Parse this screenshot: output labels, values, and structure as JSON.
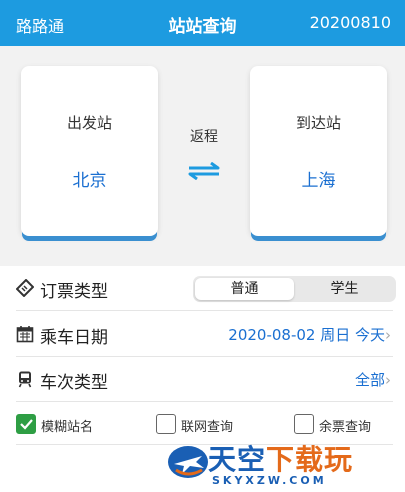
{
  "header": {
    "left": "路路通",
    "title": "站站查询",
    "right": "20200810"
  },
  "stations": {
    "from_label": "出发站",
    "from_city": "北京",
    "round_trip": "返程",
    "to_label": "到达站",
    "to_city": "上海"
  },
  "ticket_type": {
    "label": "订票类型",
    "options": [
      "普通",
      "学生"
    ],
    "selected": "普通"
  },
  "date": {
    "label": "乘车日期",
    "value": "2020-08-02 周日 今天"
  },
  "train_type": {
    "label": "车次类型",
    "value": "全部"
  },
  "options": [
    {
      "label": "模糊站名",
      "checked": true
    },
    {
      "label": "联网查询",
      "checked": false
    },
    {
      "label": "余票查询",
      "checked": false
    }
  ],
  "watermark": {
    "cn_main": "天空",
    "cn_accent": "下载玩",
    "en": "SKYXZW.COM"
  },
  "colors": {
    "header": "#1d9be0",
    "accent": "#1a6fd1",
    "check": "#2e9e44"
  }
}
